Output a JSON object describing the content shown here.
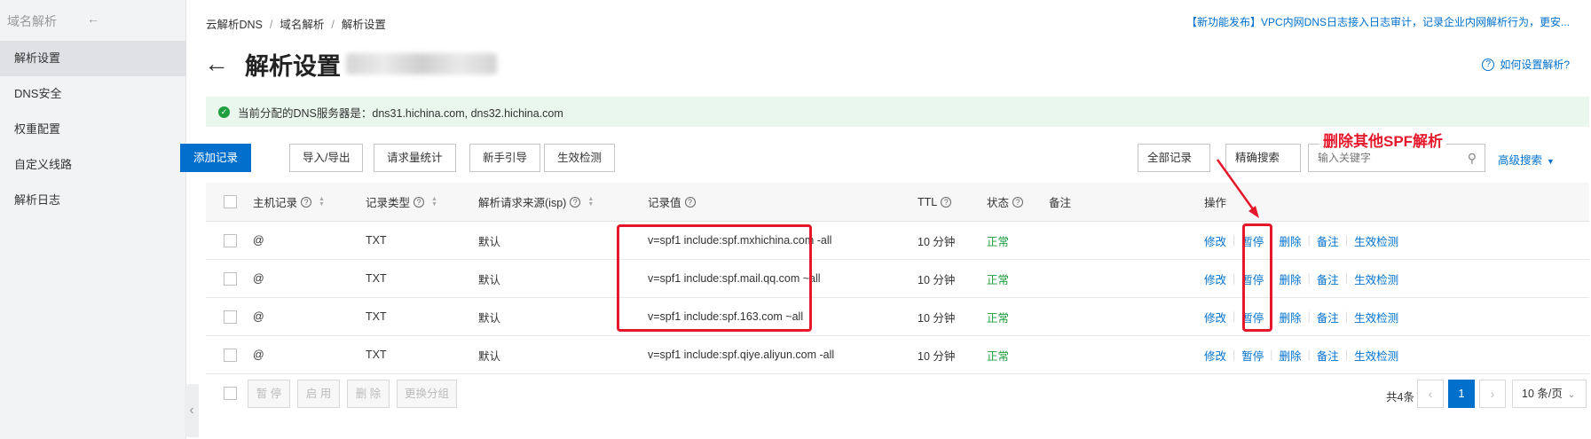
{
  "sidebar": {
    "title": "域名解析",
    "items": [
      "解析设置",
      "DNS安全",
      "权重配置",
      "自定义线路",
      "解析日志"
    ]
  },
  "breadcrumb": [
    "云解析DNS",
    "域名解析",
    "解析设置"
  ],
  "notice": "【新功能发布】VPC内网DNS日志接入日志审计，记录企业内网解析行为，更安...",
  "page_title": "解析设置",
  "help_link": "如何设置解析?",
  "dns_info": "当前分配的DNS服务器是：dns31.hichina.com, dns32.hichina.com",
  "toolbar": {
    "add": "添加记录",
    "import_export": "导入/导出",
    "stats": "请求量统计",
    "guide": "新手引导",
    "check": "生效检测",
    "filter_all": "全部记录",
    "search_mode": "精确搜索",
    "search_placeholder": "输入关键字",
    "advanced": "高级搜索"
  },
  "table": {
    "headers": {
      "host": "主机记录",
      "type": "记录类型",
      "isp": "解析请求来源(isp)",
      "value": "记录值",
      "ttl": "TTL",
      "status": "状态",
      "remark": "备注",
      "ops": "操作"
    },
    "rows": [
      {
        "host": "@",
        "type": "TXT",
        "isp": "默认",
        "value": "v=spf1 include:spf.mxhichina.com -all",
        "ttl": "10 分钟",
        "status": "正常"
      },
      {
        "host": "@",
        "type": "TXT",
        "isp": "默认",
        "value": "v=spf1 include:spf.mail.qq.com ~all",
        "ttl": "10 分钟",
        "status": "正常"
      },
      {
        "host": "@",
        "type": "TXT",
        "isp": "默认",
        "value": "v=spf1 include:spf.163.com ~all",
        "ttl": "10 分钟",
        "status": "正常"
      },
      {
        "host": "@",
        "type": "TXT",
        "isp": "默认",
        "value": "v=spf1 include:spf.qiye.aliyun.com -all",
        "ttl": "10 分钟",
        "status": "正常"
      }
    ],
    "ops": [
      "修改",
      "暂停",
      "删除",
      "备注",
      "生效检测"
    ]
  },
  "bulk": [
    "暂 停",
    "启 用",
    "删 除",
    "更换分组"
  ],
  "pagination": {
    "total": "共4条",
    "current": "1",
    "per_page": "10 条/页"
  },
  "annotation": "删除其他SPF解析",
  "colors": {
    "accent": "#0070cc",
    "success": "#1e9e3e",
    "annotation": "#e5182b"
  }
}
